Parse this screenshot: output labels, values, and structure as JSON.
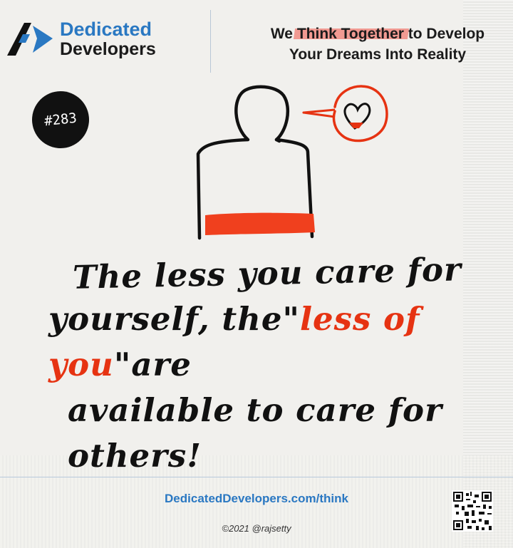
{
  "brand": {
    "line1": "Dedicated",
    "line2": "Developers"
  },
  "tagline": {
    "we": "We",
    "highlight": "Think Together",
    "rest1": "to Develop",
    "line2": "Your Dreams Into Reality"
  },
  "badge": "#283",
  "quote": {
    "line1": "The less you care for",
    "line2_a": "yourself, the\"",
    "line2_red": "less of you",
    "line2_b": "\"are",
    "line3": "available to care for others!"
  },
  "footer": {
    "url": "DedicatedDevelopers.com/think",
    "copyright": "©2021 @rajsetty"
  },
  "colors": {
    "accent_blue": "#2a78c2",
    "accent_red": "#e63312",
    "ink": "#111111"
  },
  "icons": {
    "logo": "dedicated-developers-logo",
    "qr": "qr-code",
    "heart": "heart-icon",
    "person": "person-silhouette"
  }
}
